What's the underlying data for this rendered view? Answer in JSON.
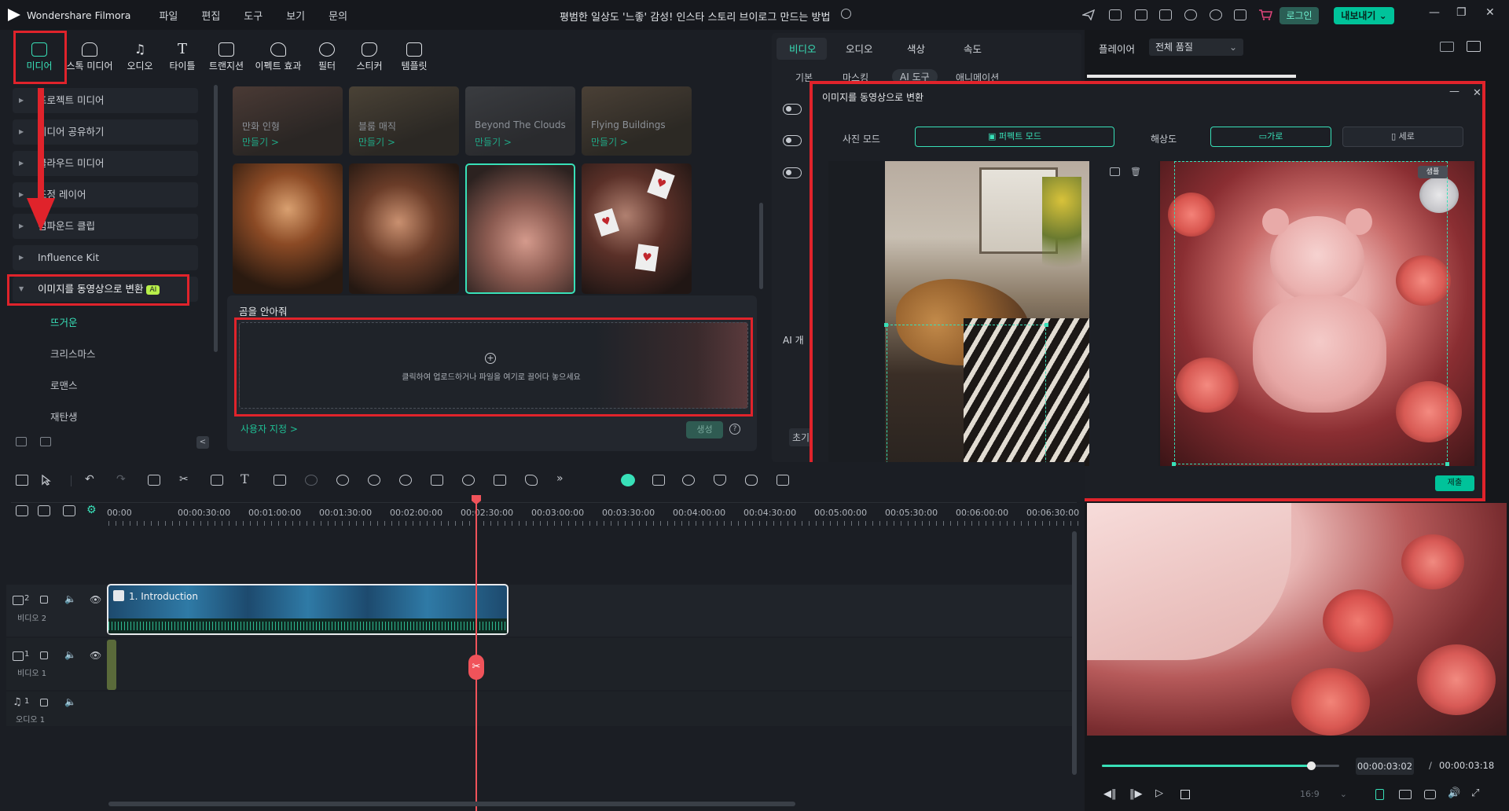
{
  "app": {
    "name": "Wondershare Filmora",
    "menus": [
      "파일",
      "편집",
      "도구",
      "보기",
      "문의"
    ],
    "window_title": "평범한 일상도 '느좋' 감성! 인스타 스토리 브이로그 만드는 방법",
    "login": "로그인",
    "export": "내보내기"
  },
  "toolbar": {
    "tools": [
      {
        "label": "미디어",
        "icon": "media-icon"
      },
      {
        "label": "스톡 미디어",
        "icon": "stock-media-icon"
      },
      {
        "label": "오디오",
        "icon": "audio-icon"
      },
      {
        "label": "타이틀",
        "icon": "title-icon"
      },
      {
        "label": "트랜지션",
        "icon": "transition-icon"
      },
      {
        "label": "이펙트 효과",
        "icon": "effects-icon"
      },
      {
        "label": "필터",
        "icon": "filter-icon"
      },
      {
        "label": "스티커",
        "icon": "sticker-icon"
      },
      {
        "label": "템플릿",
        "icon": "template-icon"
      }
    ]
  },
  "sidebar": {
    "items": [
      "프로젝트 미디어",
      "미디어 공유하기",
      "클라우드 미디어",
      "조정 레이어",
      "컴파운드 클립",
      "Influence Kit",
      "이미지를 동영상으로 변환"
    ],
    "ai_badge": "AI",
    "subitems": [
      "뜨거운",
      "크리스마스",
      "로맨스",
      "재탄생"
    ]
  },
  "library": {
    "top_cards": [
      {
        "title": "만화 인형",
        "action": "만들기 >"
      },
      {
        "title": "블룸 매직",
        "action": "만들기 >"
      },
      {
        "title": "Beyond The Clouds",
        "action": "만들기 >"
      },
      {
        "title": "Flying Buildings",
        "action": "만들기 >"
      }
    ],
    "selected_title": "곰을 안아줘",
    "upload_hint": "클릭하여 업로드하거나 파일을 여기로 끌어다 놓으세요",
    "custom_link": "사용자 지정 >",
    "generate": "생성"
  },
  "properties": {
    "tabs": [
      "비디오",
      "오디오",
      "색상",
      "속도"
    ],
    "subtabs": [
      "기본",
      "마스킹",
      "AI 도구",
      "애니메이션"
    ],
    "ai_label": "AI 개",
    "reset": "초기"
  },
  "dialog": {
    "title": "이미지를 동영상으로 변환",
    "photo_mode_label": "사진 모드",
    "photo_mode_value": "퍼펙트 모드",
    "resolution_label": "해상도",
    "res_horizontal": "가로",
    "res_vertical": "세로",
    "sample_tag": "샘플",
    "submit": "제출"
  },
  "timeline": {
    "ruler": [
      "00:00",
      "00:00:30:00",
      "00:01:00:00",
      "00:01:30:00",
      "00:02:00:00",
      "00:02:30:00",
      "00:03:00:00",
      "00:03:30:00",
      "00:04:00:00",
      "00:04:30:00",
      "00:05:00:00",
      "00:05:30:00",
      "00:06:00:00",
      "00:06:30:00"
    ],
    "tracks": [
      {
        "num": "2",
        "name": "비디오 2"
      },
      {
        "num": "1",
        "name": "비디오 1"
      },
      {
        "num": "1",
        "name": "오디오 1"
      }
    ],
    "clip_title": "1. Introduction"
  },
  "preview": {
    "player_label": "플레이어",
    "quality": "전체 품질",
    "current_time": "00:00:03:02",
    "separator": "/",
    "total_time": "00:00:03:18",
    "aspect": "16:9",
    "progress": 0.88
  },
  "colors": {
    "accent": "#00c39a",
    "highlight_red": "#e0232b",
    "playhead": "#f0535a"
  }
}
